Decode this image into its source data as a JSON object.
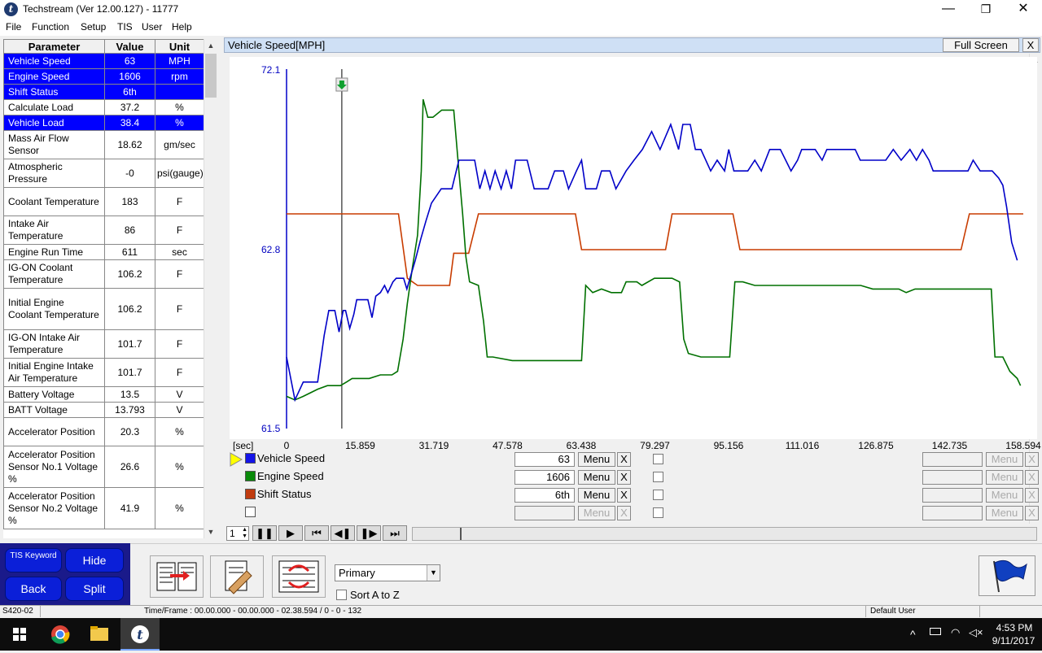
{
  "window": {
    "title": "Techstream (Ver 12.00.127) - 11777",
    "min": "—",
    "max": "❐",
    "close": "✕"
  },
  "menu": [
    "File",
    "Function",
    "Setup",
    "TIS",
    "User",
    "Help"
  ],
  "params": {
    "headers": [
      "Parameter",
      "Value",
      "Unit"
    ],
    "rows": [
      {
        "name": "Vehicle Speed",
        "value": "63",
        "unit": "MPH",
        "selected": true
      },
      {
        "name": "Engine Speed",
        "value": "1606",
        "unit": "rpm",
        "selected": true
      },
      {
        "name": "Shift Status",
        "value": "6th",
        "unit": "",
        "selected": true
      },
      {
        "name": "Calculate Load",
        "value": "37.2",
        "unit": "%",
        "selected": false
      },
      {
        "name": "Vehicle Load",
        "value": "38.4",
        "unit": "%",
        "selected": true
      },
      {
        "name": "Mass Air Flow Sensor",
        "value": "18.62",
        "unit": "gm/sec",
        "selected": false
      },
      {
        "name": "Atmospheric Pressure",
        "value": "-0",
        "unit": "psi(gauge)",
        "selected": false
      },
      {
        "name": "Coolant Temperature",
        "value": "183",
        "unit": "F",
        "selected": false
      },
      {
        "name": "Intake Air Temperature",
        "value": "86",
        "unit": "F",
        "selected": false
      },
      {
        "name": "Engine Run Time",
        "value": "611",
        "unit": "sec",
        "selected": false
      },
      {
        "name": "IG-ON Coolant Temperature",
        "value": "106.2",
        "unit": "F",
        "selected": false
      },
      {
        "name": "Initial Engine Coolant Temperature",
        "value": "106.2",
        "unit": "F",
        "selected": false
      },
      {
        "name": "IG-ON Intake Air Temperature",
        "value": "101.7",
        "unit": "F",
        "selected": false
      },
      {
        "name": "Initial Engine Intake Air Temperature",
        "value": "101.7",
        "unit": "F",
        "selected": false
      },
      {
        "name": "Battery Voltage",
        "value": "13.5",
        "unit": "V",
        "selected": false
      },
      {
        "name": "BATT Voltage",
        "value": "13.793",
        "unit": "V",
        "selected": false
      },
      {
        "name": "Accelerator Position",
        "value": "20.3",
        "unit": "%",
        "selected": false
      },
      {
        "name": "Accelerator Position Sensor No.1 Voltage %",
        "value": "26.6",
        "unit": "%",
        "selected": false
      },
      {
        "name": "Accelerator Position Sensor No.2 Voltage %",
        "value": "41.9",
        "unit": "%",
        "selected": false
      }
    ]
  },
  "graph": {
    "title": "Vehicle Speed[MPH]",
    "fullscreen": "Full Screen",
    "close": "X",
    "sec_label": "[sec]",
    "y_top": "72.1",
    "y_mid": "62.8",
    "y_bottom": "61.5",
    "x_ticks": [
      "0",
      "15.859",
      "31.719",
      "47.578",
      "63.438",
      "79.297",
      "95.156",
      "111.016",
      "126.875",
      "142.735",
      "158.594"
    ]
  },
  "chart_data": {
    "type": "line",
    "xlabel": "[sec]",
    "x_ticks": [
      0,
      15.859,
      31.719,
      47.578,
      63.438,
      79.297,
      95.156,
      111.016,
      126.875,
      142.735,
      158.594
    ],
    "ylim": [
      61.5,
      72.1
    ],
    "y_ticks": [
      61.5,
      62.8,
      72.1
    ],
    "cursor_x": 11.9,
    "series": [
      {
        "name": "Vehicle Speed",
        "color": "#0000c8",
        "points": [
          [
            0,
            0.2
          ],
          [
            1.8,
            0.08
          ],
          [
            3.6,
            0.13
          ],
          [
            6.7,
            0.13
          ],
          [
            8.1,
            0.26
          ],
          [
            9.1,
            0.33
          ],
          [
            10.4,
            0.33
          ],
          [
            11.3,
            0.27
          ],
          [
            12.2,
            0.33
          ],
          [
            12.7,
            0.33
          ],
          [
            13.6,
            0.28
          ],
          [
            14.5,
            0.32
          ],
          [
            15.1,
            0.36
          ],
          [
            17.5,
            0.36
          ],
          [
            18.4,
            0.31
          ],
          [
            19.2,
            0.37
          ],
          [
            20.2,
            0.38
          ],
          [
            21.1,
            0.4
          ],
          [
            21.8,
            0.38
          ],
          [
            22.9,
            0.41
          ],
          [
            23.6,
            0.42
          ],
          [
            25.2,
            0.42
          ],
          [
            25.9,
            0.39
          ],
          [
            26.8,
            0.43
          ],
          [
            27.7,
            0.47
          ],
          [
            28.9,
            0.53
          ],
          [
            30.0,
            0.58
          ],
          [
            31.2,
            0.63
          ],
          [
            33.3,
            0.67
          ],
          [
            35.6,
            0.67
          ],
          [
            37.1,
            0.75
          ],
          [
            40.5,
            0.75
          ],
          [
            41.6,
            0.67
          ],
          [
            42.7,
            0.72
          ],
          [
            43.8,
            0.67
          ],
          [
            44.9,
            0.72
          ],
          [
            46.2,
            0.67
          ],
          [
            47.3,
            0.72
          ],
          [
            48.4,
            0.67
          ],
          [
            49.3,
            0.75
          ],
          [
            51.8,
            0.75
          ],
          [
            53.3,
            0.67
          ],
          [
            56.3,
            0.67
          ],
          [
            57.7,
            0.72
          ],
          [
            59.6,
            0.72
          ],
          [
            60.7,
            0.67
          ],
          [
            62.4,
            0.72
          ],
          [
            63.5,
            0.75
          ],
          [
            64.4,
            0.67
          ],
          [
            66.7,
            0.67
          ],
          [
            67.8,
            0.72
          ],
          [
            69.6,
            0.72
          ],
          [
            70.9,
            0.67
          ],
          [
            73.1,
            0.72
          ],
          [
            74.8,
            0.75
          ],
          [
            76.6,
            0.78
          ],
          [
            78.6,
            0.83
          ],
          [
            80.4,
            0.78
          ],
          [
            82.7,
            0.85
          ],
          [
            84.4,
            0.78
          ],
          [
            85.3,
            0.85
          ],
          [
            86.9,
            0.85
          ],
          [
            88.0,
            0.78
          ],
          [
            89.2,
            0.78
          ],
          [
            91.3,
            0.72
          ],
          [
            92.7,
            0.75
          ],
          [
            94.3,
            0.72
          ],
          [
            95.2,
            0.78
          ],
          [
            96.3,
            0.72
          ],
          [
            99.3,
            0.72
          ],
          [
            100.8,
            0.75
          ],
          [
            102.2,
            0.72
          ],
          [
            104.0,
            0.78
          ],
          [
            106.3,
            0.78
          ],
          [
            108.6,
            0.72
          ],
          [
            110.0,
            0.75
          ],
          [
            110.9,
            0.78
          ],
          [
            113.8,
            0.78
          ],
          [
            115.3,
            0.75
          ],
          [
            116.3,
            0.78
          ],
          [
            122.4,
            0.78
          ],
          [
            123.5,
            0.75
          ],
          [
            129.0,
            0.75
          ],
          [
            130.6,
            0.78
          ],
          [
            132.3,
            0.75
          ],
          [
            134.2,
            0.78
          ],
          [
            135.6,
            0.75
          ],
          [
            136.9,
            0.78
          ],
          [
            138.3,
            0.75
          ],
          [
            139.2,
            0.72
          ],
          [
            146.7,
            0.72
          ],
          [
            147.8,
            0.75
          ],
          [
            149.3,
            0.72
          ],
          [
            151.9,
            0.72
          ],
          [
            153.3,
            0.7
          ],
          [
            154.2,
            0.68
          ],
          [
            155.0,
            0.62
          ],
          [
            156.1,
            0.52
          ],
          [
            157.3,
            0.47
          ]
        ]
      },
      {
        "name": "Engine Speed",
        "color": "#007000",
        "points": [
          [
            0,
            0.09
          ],
          [
            1.8,
            0.08
          ],
          [
            3.6,
            0.09
          ],
          [
            6.7,
            0.11
          ],
          [
            8.8,
            0.12
          ],
          [
            11.6,
            0.12
          ],
          [
            12.9,
            0.13
          ],
          [
            14.1,
            0.14
          ],
          [
            17.8,
            0.14
          ],
          [
            20.2,
            0.15
          ],
          [
            22.7,
            0.15
          ],
          [
            23.9,
            0.16
          ],
          [
            25.1,
            0.25
          ],
          [
            26.0,
            0.35
          ],
          [
            27.1,
            0.45
          ],
          [
            28.2,
            0.54
          ],
          [
            29.0,
            0.72
          ],
          [
            29.4,
            0.92
          ],
          [
            30.4,
            0.87
          ],
          [
            31.5,
            0.87
          ],
          [
            33.4,
            0.89
          ],
          [
            36.0,
            0.89
          ],
          [
            37.1,
            0.72
          ],
          [
            37.9,
            0.6
          ],
          [
            38.6,
            0.48
          ],
          [
            39.4,
            0.41
          ],
          [
            41.3,
            0.4
          ],
          [
            42.4,
            0.3
          ],
          [
            43.2,
            0.2
          ],
          [
            44.4,
            0.2
          ],
          [
            48.6,
            0.19
          ],
          [
            54.6,
            0.19
          ],
          [
            58.3,
            0.19
          ],
          [
            63.5,
            0.19
          ],
          [
            64.4,
            0.4
          ],
          [
            65.9,
            0.38
          ],
          [
            67.8,
            0.39
          ],
          [
            69.9,
            0.38
          ],
          [
            72.1,
            0.38
          ],
          [
            73.1,
            0.41
          ],
          [
            75.4,
            0.41
          ],
          [
            76.5,
            0.4
          ],
          [
            79.2,
            0.42
          ],
          [
            83.0,
            0.42
          ],
          [
            84.6,
            0.41
          ],
          [
            85.5,
            0.25
          ],
          [
            86.5,
            0.21
          ],
          [
            89.2,
            0.2
          ],
          [
            93.1,
            0.2
          ],
          [
            94.4,
            0.2
          ],
          [
            95.4,
            0.2
          ],
          [
            96.5,
            0.41
          ],
          [
            98.2,
            0.41
          ],
          [
            100.8,
            0.4
          ],
          [
            103.0,
            0.4
          ],
          [
            106.3,
            0.4
          ],
          [
            111.3,
            0.4
          ],
          [
            115.3,
            0.4
          ],
          [
            117.8,
            0.4
          ],
          [
            120.7,
            0.4
          ],
          [
            123.6,
            0.4
          ],
          [
            126.2,
            0.39
          ],
          [
            128.9,
            0.39
          ],
          [
            131.8,
            0.39
          ],
          [
            133.4,
            0.38
          ],
          [
            135.3,
            0.39
          ],
          [
            139.4,
            0.39
          ],
          [
            146.6,
            0.39
          ],
          [
            148.8,
            0.39
          ],
          [
            150.3,
            0.39
          ],
          [
            151.7,
            0.39
          ],
          [
            152.5,
            0.2
          ],
          [
            154.2,
            0.2
          ],
          [
            155.7,
            0.16
          ],
          [
            157.3,
            0.14
          ],
          [
            158.0,
            0.12
          ]
        ]
      },
      {
        "name": "Shift Status",
        "color": "#c83c00",
        "points": [
          [
            0,
            0.6
          ],
          [
            24.1,
            0.6
          ],
          [
            26.0,
            0.42
          ],
          [
            28.2,
            0.4
          ],
          [
            35.1,
            0.4
          ],
          [
            36.0,
            0.49
          ],
          [
            39.2,
            0.49
          ],
          [
            41.3,
            0.6
          ],
          [
            62.2,
            0.6
          ],
          [
            63.5,
            0.5
          ],
          [
            81.6,
            0.5
          ],
          [
            83.0,
            0.6
          ],
          [
            96.1,
            0.6
          ],
          [
            97.6,
            0.5
          ],
          [
            145.2,
            0.5
          ],
          [
            147.0,
            0.6
          ],
          [
            158.6,
            0.6
          ]
        ]
      }
    ]
  },
  "legend": [
    {
      "name": "Vehicle Speed",
      "color": "#1414e8",
      "value": "63",
      "menu": "Menu",
      "x": "X",
      "active": true
    },
    {
      "name": "Engine Speed",
      "color": "#0a8a0a",
      "value": "1606",
      "menu": "Menu",
      "x": "X",
      "active": true
    },
    {
      "name": "Shift Status",
      "color": "#c03c10",
      "value": "6th",
      "menu": "Menu",
      "x": "X",
      "active": true
    },
    {
      "name": "",
      "color": "",
      "value": "",
      "menu": "Menu",
      "x": "X",
      "active": false
    }
  ],
  "right_menus": [
    "Menu",
    "Menu",
    "Menu",
    "Menu"
  ],
  "playback": {
    "frame": "1"
  },
  "bottom": {
    "tis_keyword": "TIS Keyword",
    "hide": "Hide",
    "back": "Back",
    "split": "Split",
    "dropdown": "Primary",
    "sort_label": "Sort A to Z"
  },
  "status": {
    "left": "S420-02",
    "timeframe": "Time/Frame : 00.00.000 - 00.00.000 - 02.38.594 / 0 - 0 - 132",
    "user": "Default User"
  },
  "taskbar": {
    "time": "4:53 PM",
    "date": "9/11/2017"
  }
}
